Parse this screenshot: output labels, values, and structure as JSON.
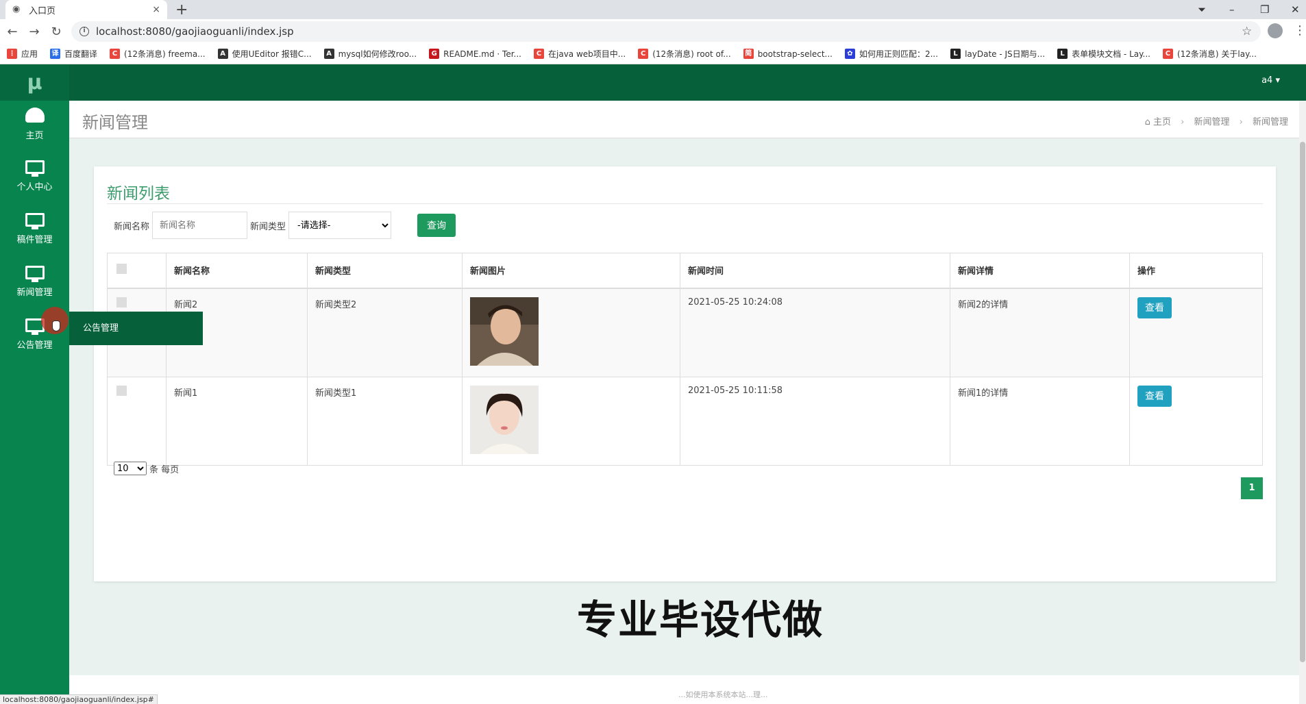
{
  "browser": {
    "tab_title": "入口页",
    "tab_close": "×",
    "new_tab": "+",
    "url": "localhost:8080/gaojiaoguanli/index.jsp",
    "win_min": "–",
    "win_max": "❐",
    "win_close": "✕",
    "status_url": "localhost:8080/gaojiaoguanli/index.jsp#",
    "bookmarks": [
      {
        "label": "应用",
        "color": "#e8453c",
        "glyph": "⋮"
      },
      {
        "label": "百度翻译",
        "color": "#2b6de8",
        "glyph": "译"
      },
      {
        "label": "(12条消息) freema...",
        "color": "#e8453c",
        "glyph": "C"
      },
      {
        "label": "使用UEditor 报错C...",
        "color": "#333333",
        "glyph": "A"
      },
      {
        "label": "mysql如何修改roo...",
        "color": "#333333",
        "glyph": "A"
      },
      {
        "label": "README.md · Ter...",
        "color": "#c7161e",
        "glyph": "G"
      },
      {
        "label": "在java web项目中...",
        "color": "#e8453c",
        "glyph": "C"
      },
      {
        "label": "(12条消息) root of...",
        "color": "#e8453c",
        "glyph": "C"
      },
      {
        "label": "bootstrap-select...",
        "color": "#e8453c",
        "glyph": "简"
      },
      {
        "label": "如何用正则匹配：2...",
        "color": "#2b3ed8",
        "glyph": "✿"
      },
      {
        "label": "layDate - JS日期与...",
        "color": "#222222",
        "glyph": "L"
      },
      {
        "label": "表单模块文档 - Lay...",
        "color": "#222222",
        "glyph": "L"
      },
      {
        "label": "(12条消息) 关于lay...",
        "color": "#e8453c",
        "glyph": "C"
      }
    ]
  },
  "sidebar": {
    "logo": "μ",
    "items": [
      {
        "label": "主页",
        "icon": "dashboard-icon"
      },
      {
        "label": "个人中心",
        "icon": "monitor-icon"
      },
      {
        "label": "稿件管理",
        "icon": "monitor-icon"
      },
      {
        "label": "新闻管理",
        "icon": "monitor-icon"
      },
      {
        "label": "公告管理",
        "icon": "monitor-icon"
      }
    ],
    "flyout": "公告管理"
  },
  "topbar": {
    "user": "a4 ▾"
  },
  "page": {
    "title": "新闻管理",
    "breadcrumb": [
      "主页",
      "新闻管理",
      "新闻管理"
    ]
  },
  "panel": {
    "title": "新闻列表",
    "filter": {
      "name_label": "新闻名称",
      "name_placeholder": "新闻名称",
      "type_label": "新闻类型",
      "type_selected": "-请选择-",
      "query_button": "查询"
    },
    "table": {
      "headers": [
        "新闻名称",
        "新闻类型",
        "新闻图片",
        "新闻时间",
        "新闻详情",
        "操作"
      ],
      "rows": [
        {
          "name": "新闻2",
          "type": "新闻类型2",
          "image": "portrait-man",
          "time": "2021-05-25 10:24:08",
          "detail": "新闻2的详情",
          "action": "查看"
        },
        {
          "name": "新闻1",
          "type": "新闻类型1",
          "image": "portrait-woman",
          "time": "2021-05-25 10:11:58",
          "detail": "新闻1的详情",
          "action": "查看"
        }
      ]
    },
    "pagination": {
      "page_size": "10",
      "page_size_suffix": "条 每页",
      "current_page": "1"
    }
  },
  "footer": {
    "text": "...如使用本系统本站...理..."
  },
  "watermark": "专业毕设代做"
}
